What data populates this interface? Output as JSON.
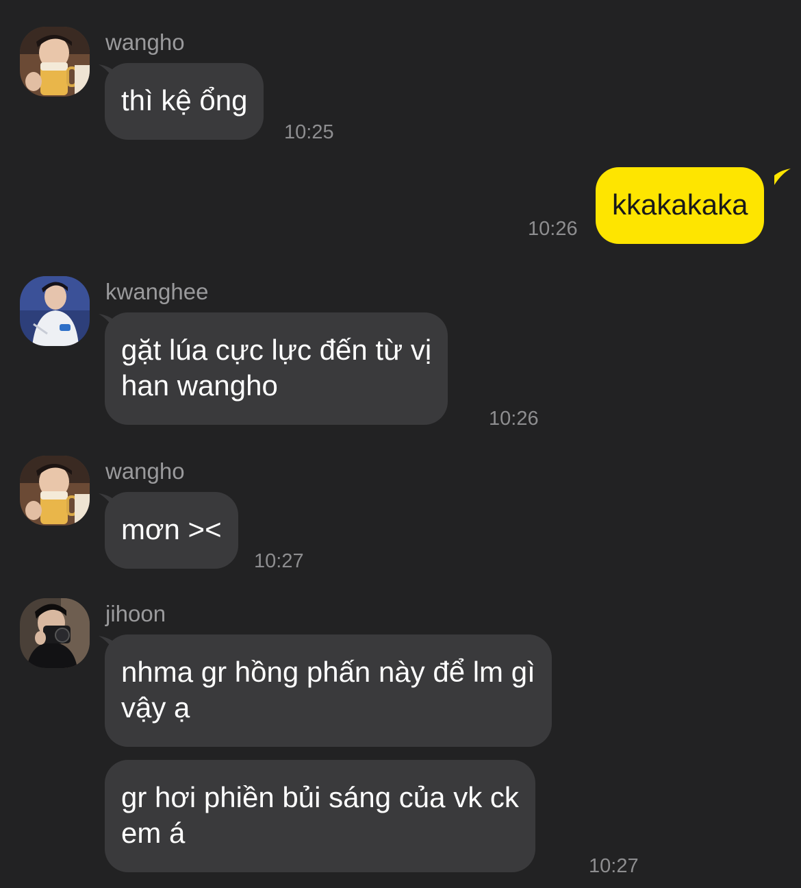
{
  "colors": {
    "background": "#222223",
    "incoming_bubble": "#3a3a3c",
    "outgoing_bubble": "#fee500",
    "sender_name": "#9a9a9c",
    "timestamp": "#8e8e90"
  },
  "messages": [
    {
      "sender": "wangho",
      "avatar": "beer-glass-portrait",
      "lines": [
        "thì kệ ổng"
      ],
      "time": "10:25"
    },
    {
      "sender": "",
      "outgoing": true,
      "lines": [
        "kkakakaka"
      ],
      "time": "10:26"
    },
    {
      "sender": "kwanghee",
      "avatar": "white-hoodie-portrait",
      "lines": [
        "gặt lúa cực lực đến từ vị",
        "han wangho"
      ],
      "time": "10:26"
    },
    {
      "sender": "wangho",
      "avatar": "beer-glass-portrait",
      "lines": [
        "mơn ><"
      ],
      "time": "10:27"
    },
    {
      "sender": "jihoon",
      "avatar": "camera-portrait",
      "lines": [
        "nhma gr hồng phấn này để lm gì",
        "vậy ạ"
      ],
      "time": ""
    },
    {
      "sender": "",
      "lines": [
        "gr hơi phiền bủi sáng của vk ck",
        "em á"
      ],
      "time": "10:27"
    }
  ]
}
